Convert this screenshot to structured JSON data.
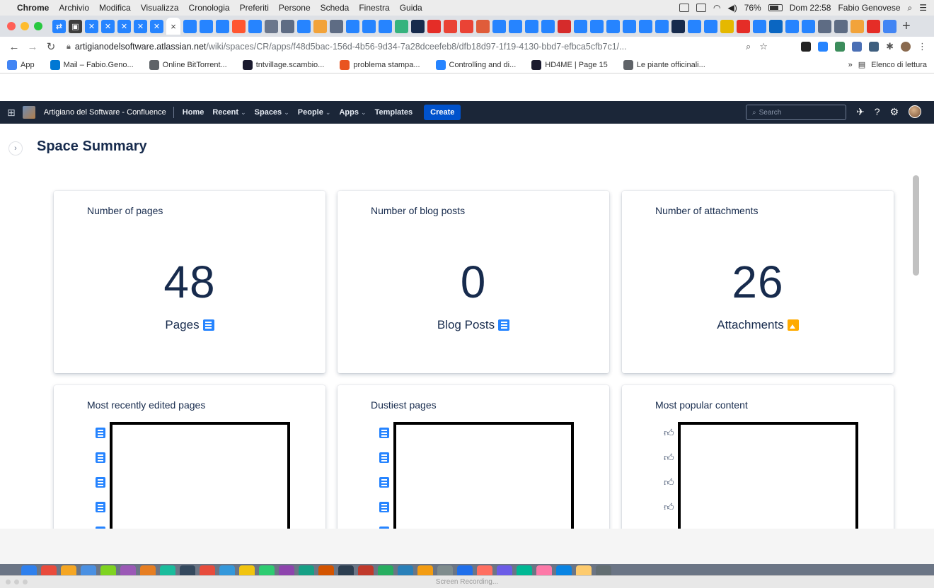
{
  "mac_menubar": {
    "app_name": "Chrome",
    "menus": [
      "Archivio",
      "Modifica",
      "Visualizza",
      "Cronologia",
      "Preferiti",
      "Persone",
      "Scheda",
      "Finestra",
      "Guida"
    ],
    "battery": "76%",
    "clock": "Dom 22:58",
    "user": "Fabio Genovese"
  },
  "browser": {
    "tab_close": "×",
    "new_tab": "+",
    "url_host": "artigianodelsoftware.atlassian.net",
    "url_path": "/wiki/spaces/CR/apps/f48d5bac-156d-4b56-9d34-7a28dceefeb8/dfb18d97-1f19-4130-bbd7-efbca5cfb7c1/...",
    "bookmarks": [
      {
        "label": "App",
        "color": "#4285f4"
      },
      {
        "label": "Mail – Fabio.Geno...",
        "color": "#0078d4"
      },
      {
        "label": "Online BitTorrent...",
        "color": "#5f6368"
      },
      {
        "label": "tntvillage.scambio...",
        "color": "#1a1a2e"
      },
      {
        "label": "problema stampa...",
        "color": "#e95420"
      },
      {
        "label": "Controlling and di...",
        "color": "#2684ff"
      },
      {
        "label": "HD4ME | Page 15",
        "color": "#1a1a2e"
      },
      {
        "label": "Le piante officinali...",
        "color": "#5f6368"
      }
    ],
    "overflow_chevron": "»",
    "reading_list": "Elenco di lettura"
  },
  "confluence": {
    "site_title": "Artigiano del Software - Confluence",
    "nav": {
      "home": "Home",
      "recent": "Recent",
      "spaces": "Spaces",
      "people": "People",
      "apps": "Apps",
      "templates": "Templates"
    },
    "create_label": "Create",
    "search_placeholder": "Search"
  },
  "page": {
    "title": "Space Summary",
    "stats": [
      {
        "label": "Number of pages",
        "value": "48",
        "unit": "Pages",
        "icon": "page-icon"
      },
      {
        "label": "Number of blog posts",
        "value": "0",
        "unit": "Blog Posts",
        "icon": "page-icon"
      },
      {
        "label": "Number of attachments",
        "value": "26",
        "unit": "Attachments",
        "icon": "image-icon"
      }
    ],
    "lists": [
      {
        "label": "Most recently edited pages",
        "icon": "page-icon"
      },
      {
        "label": "Dustiest pages",
        "icon": "page-icon"
      },
      {
        "label": "Most popular content",
        "icon": "thumbs-up-icon"
      }
    ]
  },
  "recording": {
    "title": "Screen Recording..."
  },
  "colors": {
    "confluence_header": "#1b2638",
    "create_button": "#0052cc",
    "page_icon": "#2684ff",
    "attachment_icon": "#ffab00",
    "text_primary": "#172b4d"
  }
}
